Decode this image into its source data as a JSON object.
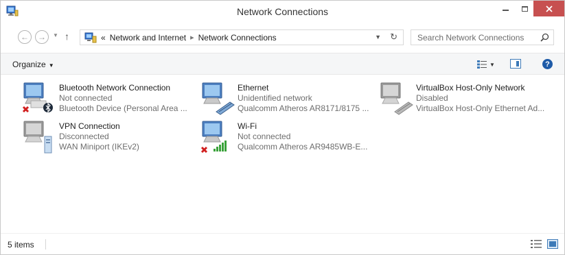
{
  "window": {
    "title": "Network Connections"
  },
  "address": {
    "overflow": "«",
    "crumbs": [
      "Network and Internet",
      "Network Connections"
    ],
    "search_placeholder": "Search Network Connections"
  },
  "toolbar": {
    "organize_label": "Organize"
  },
  "connections": [
    {
      "name": "Bluetooth Network Connection",
      "status": "Not connected",
      "device": "Bluetooth Device (Personal Area ...",
      "icon": "bluetooth-adapter-icon",
      "error": true
    },
    {
      "name": "Ethernet",
      "status": "Unidentified network",
      "device": "Qualcomm Atheros AR8171/8175 ...",
      "icon": "ethernet-adapter-icon",
      "error": false
    },
    {
      "name": "VirtualBox Host-Only Network",
      "status": "Disabled",
      "device": "VirtualBox Host-Only Ethernet Ad...",
      "icon": "ethernet-adapter-disabled-icon",
      "error": false
    },
    {
      "name": "VPN Connection",
      "status": "Disconnected",
      "device": "WAN Miniport (IKEv2)",
      "icon": "vpn-adapter-icon",
      "error": false
    },
    {
      "name": "Wi-Fi",
      "status": "Not connected",
      "device": "Qualcomm Atheros AR9485WB-E...",
      "icon": "wifi-adapter-icon",
      "error": true
    }
  ],
  "status": {
    "count": "5 items"
  },
  "colors": {
    "close_button": "#c75050",
    "help": "#1e5ba8",
    "error": "#d11f1f",
    "signal": "#3aa23a"
  }
}
